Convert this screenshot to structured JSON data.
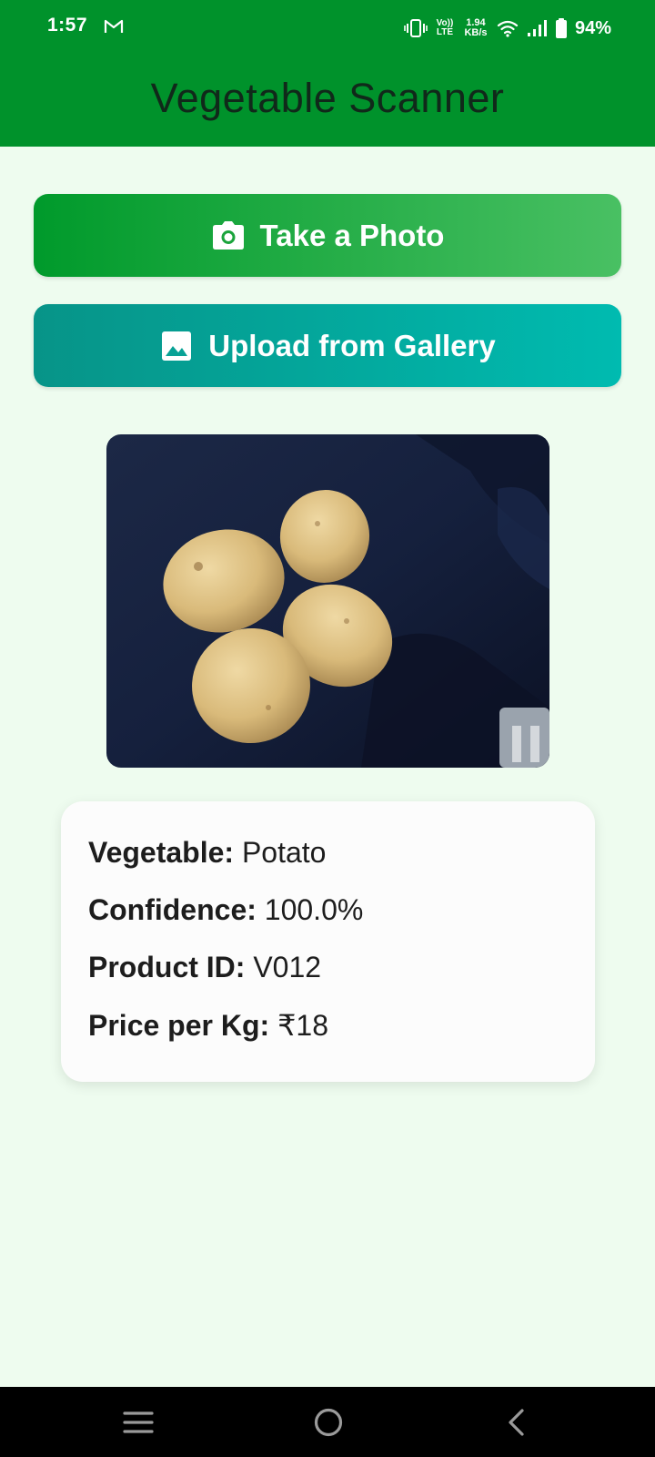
{
  "status_bar": {
    "time": "1:57",
    "volte": [
      "Vo))",
      "LTE"
    ],
    "net_speed": [
      "1.94",
      "KB/s"
    ],
    "battery": "94%"
  },
  "header": {
    "title": "Vegetable Scanner"
  },
  "buttons": {
    "take_photo": {
      "label": "Take a Photo",
      "icon": "camera-icon"
    },
    "upload_gallery": {
      "label": "Upload from Gallery",
      "icon": "image-icon"
    }
  },
  "result": {
    "vegetable_label": "Vegetable:",
    "vegetable_value": "Potato",
    "confidence_label": "Confidence:",
    "confidence_value": "100.0%",
    "product_id_label": "Product ID:",
    "product_id_value": "V012",
    "price_label": "Price per Kg:",
    "price_value": "₹18"
  },
  "nav": {
    "icons": [
      "menu-icon",
      "home-icon",
      "back-icon"
    ]
  },
  "colors": {
    "header": "#00922b",
    "background": "#eefcef",
    "photo_button_start": "#009a2b",
    "photo_button_end": "#49c063",
    "gallery_button_start": "#079488",
    "gallery_button_end": "#00bbb0"
  }
}
